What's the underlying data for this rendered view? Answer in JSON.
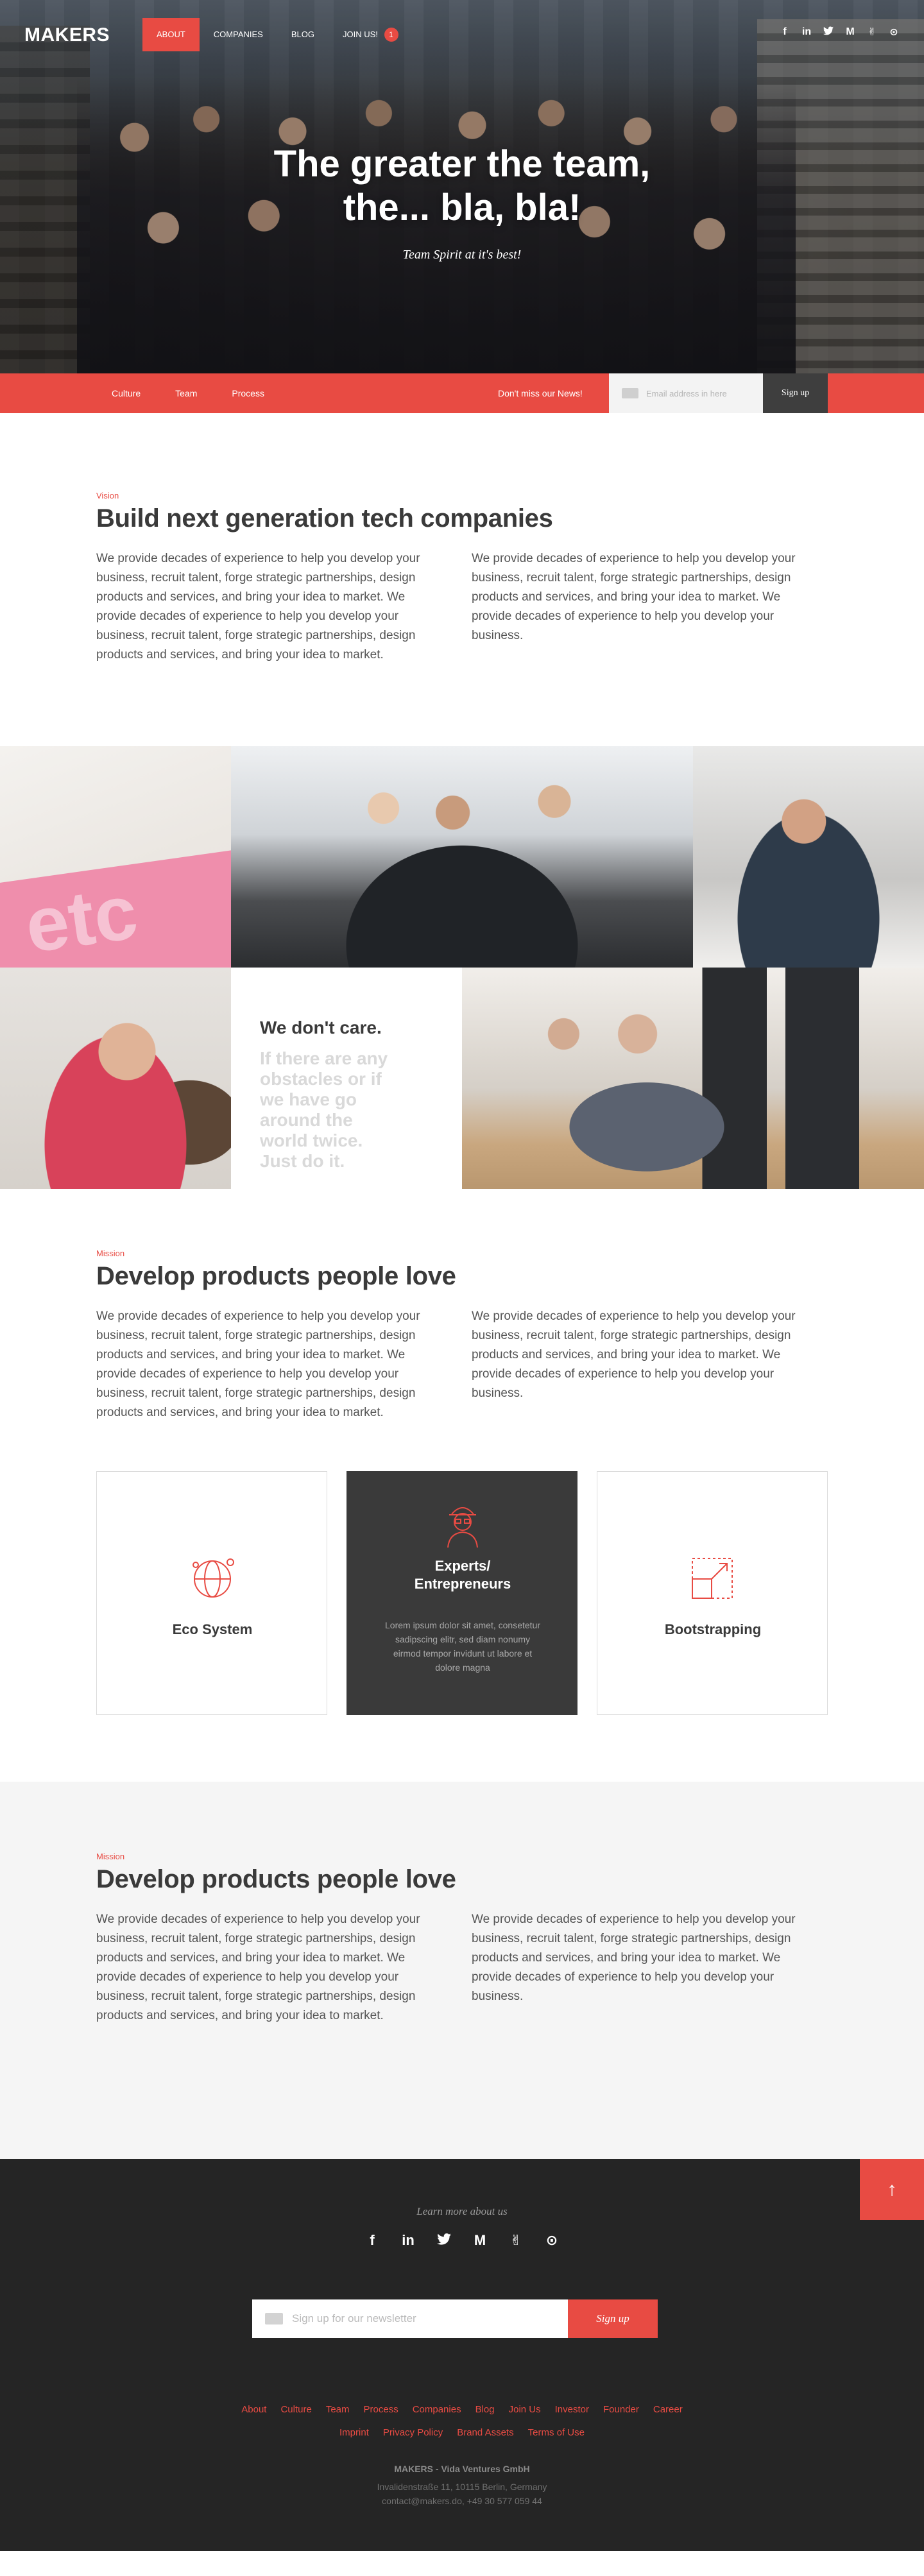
{
  "nav": {
    "logo": "MAKERS",
    "items": [
      {
        "label": "ABOUT",
        "active": true
      },
      {
        "label": "COMPANIES",
        "active": false
      },
      {
        "label": "BLOG",
        "active": false
      },
      {
        "label": "JOIN US!",
        "active": false,
        "badge": "1"
      }
    ],
    "social": [
      "f",
      "in",
      "t",
      "M",
      "✌",
      "⊙"
    ]
  },
  "hero": {
    "title_line1": "The greater the team,",
    "title_line2": "the... bla, bla!",
    "subtitle": "Team Spirit at it's best!"
  },
  "subnav": {
    "links": [
      "Culture",
      "Team",
      "Process"
    ],
    "news_label": "Don't miss our News!",
    "email_placeholder": "Email address in here",
    "signup_label": "Sign up"
  },
  "vision": {
    "kicker": "Vision",
    "title": "Build next generation tech companies",
    "col_left": "We provide decades of experience to help you develop your business, recruit talent, forge strategic partnerships, design products and services, and bring your idea to market. We provide decades of experience to help you develop your business, recruit talent, forge strategic partnerships, design products and services, and bring your idea to market.",
    "col_right": "We provide decades of experience to help you develop your business, recruit talent, forge strategic partnerships, design products and services, and bring your idea to market. We provide decades of experience to help you develop your business."
  },
  "grid": {
    "sign_text": "etc",
    "care_title": "We don't care.",
    "care_text": "If there are any obstacles or if we have go around the world twice. Just do it."
  },
  "mission": {
    "kicker": "Mission",
    "title": "Develop products people love",
    "col_left": "We provide decades of experience to help you develop your business, recruit talent, forge strategic partnerships, design products and services, and bring your idea to market. We provide decades of experience to help you develop your business, recruit talent, forge strategic partnerships, design products and services, and bring your idea to market.",
    "col_right": "We provide decades of experience to help you develop your business, recruit talent, forge strategic partnerships, design products and services, and bring your idea to market. We provide decades of experience to help you develop your business."
  },
  "cards": [
    {
      "title": "Eco System",
      "icon": "globe-icon"
    },
    {
      "title_line1": "Experts/",
      "title_line2": "Entrepreneurs",
      "icon": "expert-icon",
      "description": "Lorem ipsum dolor sit amet, consetetur sadipscing elitr, sed diam nonumy eirmod tempor invidunt ut labore et dolore magna"
    },
    {
      "title": "Bootstrapping",
      "icon": "scale-up-icon"
    }
  ],
  "mission2": {
    "kicker": "Mission",
    "title": "Develop products people love",
    "col_left": "We provide decades of experience to help you develop your business, recruit talent, forge strategic partnerships, design products and services, and bring your idea to market. We provide decades of experience to help you develop your business, recruit talent, forge strategic partnerships, design products and services, and bring your idea to market.",
    "col_right": "We provide decades of experience to help you develop your business, recruit talent, forge strategic partnerships, design products and services, and bring your idea to market. We provide decades of experience to help you develop your business."
  },
  "footer": {
    "to_top": "↑",
    "learn_more": "Learn more about us",
    "social": [
      "f",
      "in",
      "t",
      "M",
      "✌",
      "⊙"
    ],
    "newsletter_placeholder": "Sign up for our newsletter",
    "newsletter_button": "Sign up",
    "links_row1": [
      "About",
      "Culture",
      "Team",
      "Process",
      "Companies",
      "Blog",
      "Join Us",
      "Investor",
      "Founder",
      "Career"
    ],
    "links_row2": [
      "Imprint",
      "Privacy Policy",
      "Brand Assets",
      "Terms of Use"
    ],
    "company": "MAKERS - Vida Ventures GmbH",
    "address": "Invalidenstraße 11, 10115 Berlin, Germany",
    "contact": "contact@makers.do, +49 30 577 059 44"
  },
  "colors": {
    "accent": "#e84b43",
    "dark": "#3a3a3a",
    "footer_bg": "#252525",
    "grey_bg": "#f5f5f5"
  }
}
